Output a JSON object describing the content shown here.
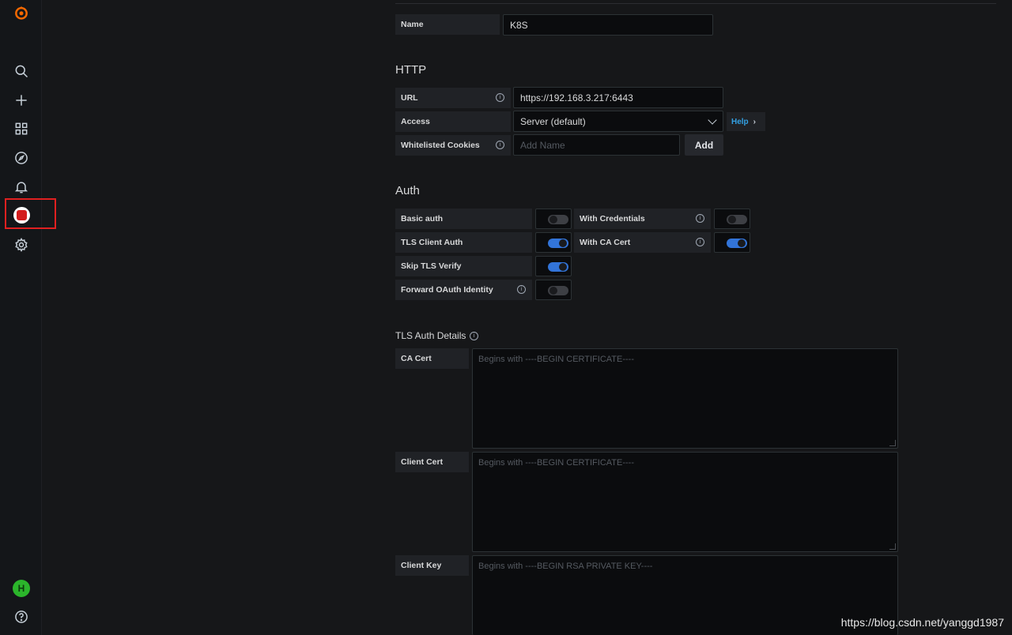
{
  "sidebar": {
    "icons": [
      "grafana-logo-icon",
      "search-icon",
      "plus-icon",
      "dashboards-icon",
      "explore-icon",
      "alerting-icon",
      "plugin-icon",
      "gear-icon",
      "user-avatar-icon",
      "help-icon"
    ],
    "avatar_glyph": "H",
    "highlight_color": "#e02020"
  },
  "name": {
    "label": "Name",
    "value": "K8S"
  },
  "http": {
    "title": "HTTP",
    "url": {
      "label": "URL",
      "value": "https://192.168.3.217:6443"
    },
    "access": {
      "label": "Access",
      "value": "Server (default)",
      "help": "Help"
    },
    "cookies": {
      "label": "Whitelisted Cookies",
      "placeholder": "Add Name",
      "add_button": "Add"
    }
  },
  "auth": {
    "title": "Auth",
    "basic_auth": {
      "label": "Basic auth",
      "on": false
    },
    "with_credentials": {
      "label": "With Credentials",
      "on": false
    },
    "tls_client_auth": {
      "label": "TLS Client Auth",
      "on": true
    },
    "with_ca_cert": {
      "label": "With CA Cert",
      "on": true
    },
    "skip_tls_verify": {
      "label": "Skip TLS Verify",
      "on": true
    },
    "forward_oauth": {
      "label": "Forward OAuth Identity",
      "on": false
    }
  },
  "tls": {
    "title": "TLS Auth Details",
    "ca_cert": {
      "label": "CA Cert",
      "placeholder": "Begins with ----BEGIN CERTIFICATE----"
    },
    "client_cert": {
      "label": "Client Cert",
      "placeholder": "Begins with ----BEGIN CERTIFICATE----"
    },
    "client_key": {
      "label": "Client Key",
      "placeholder": "Begins with ----BEGIN RSA PRIVATE KEY----"
    }
  },
  "watermark": "https://blog.csdn.net/yanggd1987",
  "colors": {
    "accent": "#3274d9",
    "link": "#33a2e5",
    "background": "#161719"
  }
}
